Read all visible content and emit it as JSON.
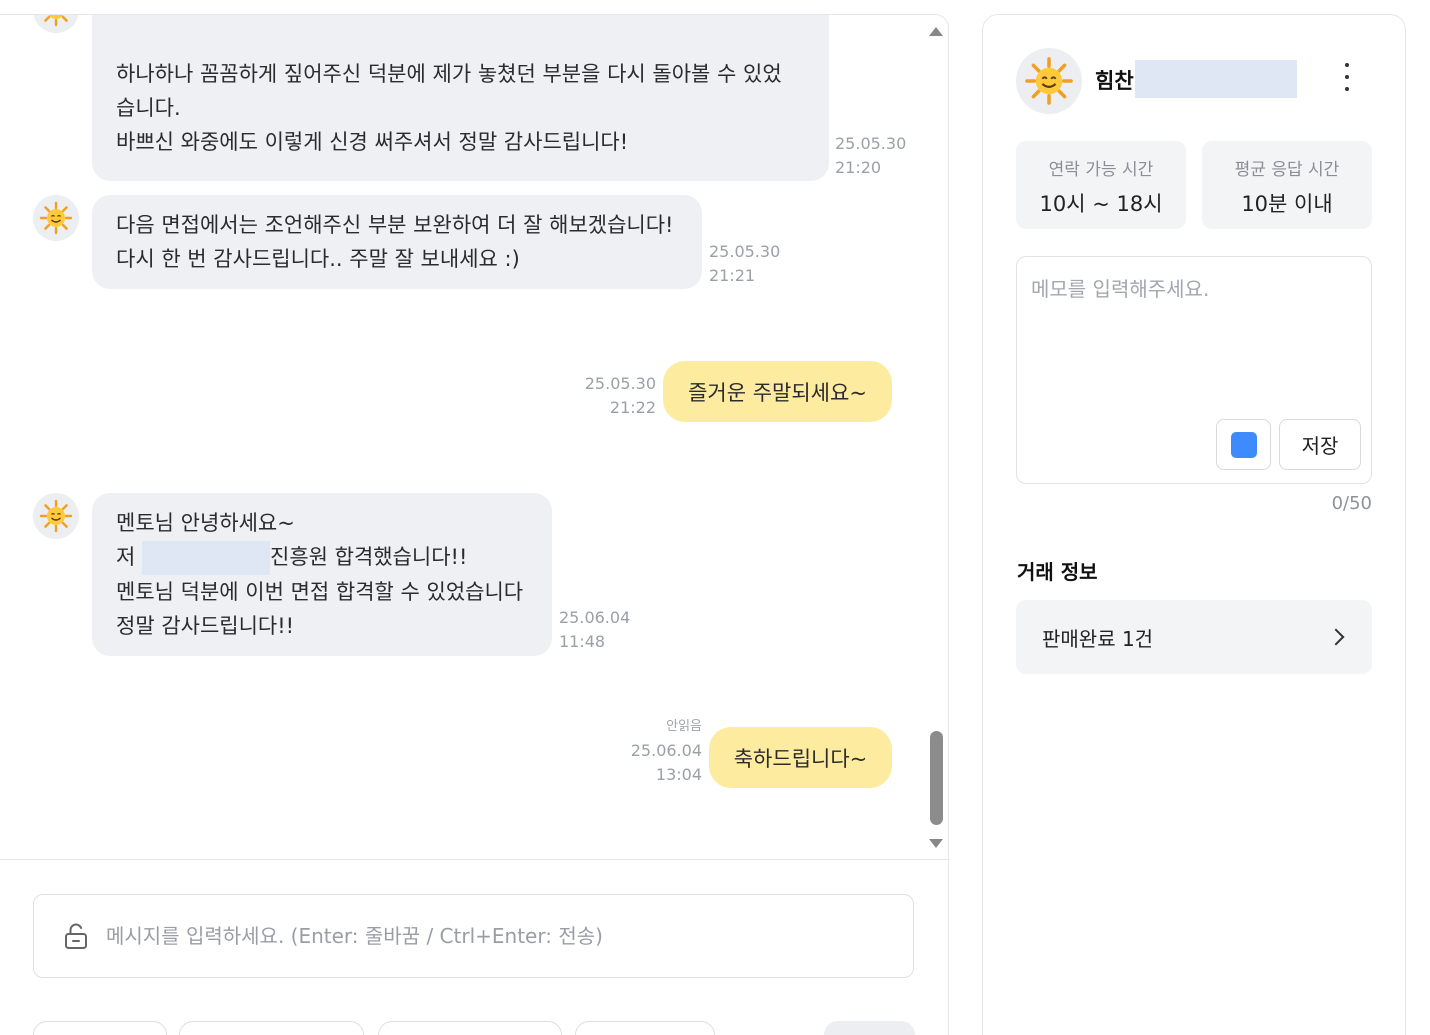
{
  "chat": {
    "messages": [
      {
        "lines": [
          "",
          "하나하나 꼼꼼하게 짚어주신 덕분에 제가 놓쳤던 부분을 다시 돌아볼 수 있었",
          "습니다.",
          "바쁘신 와중에도 이렇게 신경 써주셔서 정말 감사드립니다!"
        ],
        "date": "25.05.30",
        "time": "21:20"
      },
      {
        "lines": [
          "다음 면접에서는 조언해주신 부분 보완하여 더 잘 해보겠습니다!",
          "다시 한 번 감사드립니다.. 주말 잘 보내세요 :)"
        ],
        "date": "25.05.30",
        "time": "21:21"
      },
      {
        "text": "즐거운 주말되세요~",
        "date": "25.05.30",
        "time": "21:22"
      },
      {
        "line1": "멘토님 안녕하세요~",
        "line2_start": "저 ",
        "line2_end": "진흥원 합격했습니다!!",
        "line3": "멘토님 덕분에 이번 면접 합격할 수 있었습니다",
        "line4": "정말 감사드립니다!!",
        "date": "25.06.04",
        "time": "11:48"
      },
      {
        "text": "축하드립니다~",
        "status": "안읽음",
        "date": "25.06.04",
        "time": "13:04"
      }
    ],
    "input_placeholder": "메시지를 입력하세요. (Enter: 줄바꿈 / Ctrl+Enter: 전송)"
  },
  "profile": {
    "name": "힘찬",
    "available_label": "연락 가능 시간",
    "available_value": "10시 ~ 18시",
    "response_label": "평균 응답 시간",
    "response_value": "10분 이내"
  },
  "memo": {
    "placeholder": "메모를 입력해주세요.",
    "save_label": "저장",
    "count": "0/50",
    "color": "#3d8bff"
  },
  "trade": {
    "title": "거래 정보",
    "item": "판매완료 1건"
  },
  "colors": {
    "incoming_bubble": "#eef0f3",
    "outgoing_bubble": "#fdeca0"
  }
}
